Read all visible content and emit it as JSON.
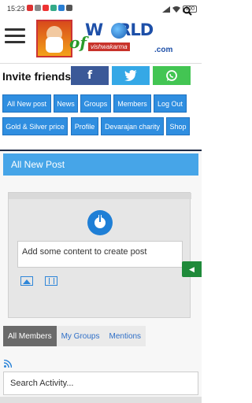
{
  "status_bar": {
    "time": "15:23",
    "battery": "100"
  },
  "header": {
    "logo_world": "W",
    "logo_world_rest": "RLD",
    "logo_of": "of",
    "logo_sub": "vishwakarma",
    "logo_com": ".com"
  },
  "invite": {
    "label": "Invite friends",
    "facebook": "f",
    "twitter": "t",
    "whatsapp": "w"
  },
  "nav": {
    "items": [
      {
        "label": "All New post"
      },
      {
        "label": "News"
      },
      {
        "label": "Groups"
      },
      {
        "label": "Members"
      },
      {
        "label": "Log Out"
      },
      {
        "label": "Gold & Silver price"
      },
      {
        "label": "Profile"
      },
      {
        "label": "Devarajan charity"
      },
      {
        "label": "Shop"
      }
    ]
  },
  "panel": {
    "title": "All New Post",
    "composer_placeholder": "Add some content to create post"
  },
  "side_tab": {
    "label": "◀"
  },
  "tabs": [
    {
      "label": "All Members",
      "active": true
    },
    {
      "label": "My Groups",
      "active": false
    },
    {
      "label": "Mentions",
      "active": false
    }
  ],
  "search": {
    "placeholder": "Search Activity..."
  },
  "colors": {
    "nav_blue": "#2f8ee0",
    "panel_head": "#46a5e8",
    "facebook": "#3b5998",
    "twitter": "#35a8e6",
    "whatsapp": "#43c553",
    "side_tab": "#1f8a3a"
  },
  "icons": {
    "menu": "hamburger-icon",
    "avatar": "user-avatar-icon",
    "image": "image-icon",
    "video": "video-icon",
    "rss": "rss-icon",
    "search": "search-icon"
  }
}
